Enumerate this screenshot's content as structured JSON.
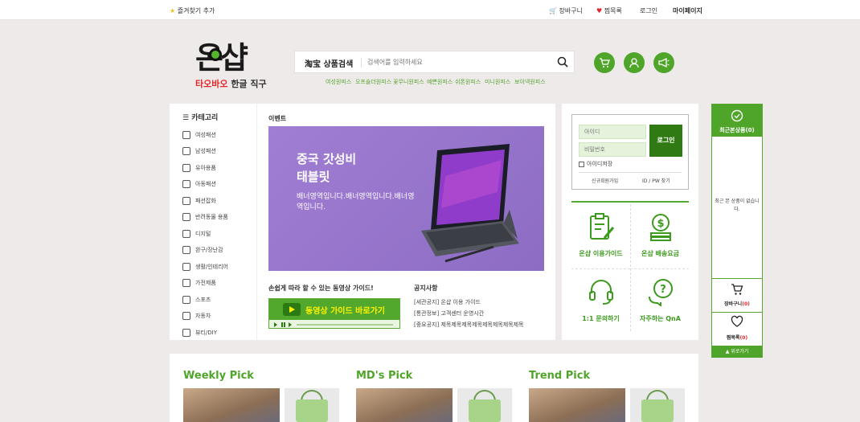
{
  "colors": {
    "brand_green": "#4ea52a",
    "dark_green": "#2f7a12",
    "accent_red": "#e2262b",
    "banner_purple": "#9a7bd0",
    "bg": "#efeaea"
  },
  "topbar": {
    "bookmark_label": "즐겨찾기 추가",
    "cart_label": "장바구니",
    "wishlist_label": "찜목록",
    "login_label": "로그인",
    "mypage_label": "마이페이지"
  },
  "logo": {
    "main": "온샵",
    "sub_red": "타오바오",
    "sub_dark": " 한글 직구"
  },
  "search": {
    "brand_label": "淘宝 상품검색",
    "placeholder": "검색어를 입력하세요",
    "suggestions": [
      "여성원피스",
      "오프숄더원피스",
      "꽃무니원피스",
      "예쁜원피스",
      "쉬폰원피스",
      "미니원피스",
      "보이넥원피스"
    ]
  },
  "header_icons": [
    "cart-icon",
    "user-icon",
    "megaphone-icon"
  ],
  "category": {
    "title": "카테고리",
    "items": [
      "여성패션",
      "남성패션",
      "유아용품",
      "아동패션",
      "패션잡화",
      "반려동물 용품",
      "디지털",
      "완구/장난감",
      "생활/인테리어",
      "가전제품",
      "스포츠",
      "자동차",
      "뷰티/DIY"
    ]
  },
  "event": {
    "title": "이벤트",
    "banner_title": "중국 갓성비\n태블릿",
    "banner_desc": "배너영역입니다.배너영역입니다.배너영역입니다."
  },
  "video_guide": {
    "title": "손쉽게 따라 할 수 있는 동영상 가이드!",
    "button_label": "동영상 가이드 바로가기"
  },
  "notice": {
    "title": "공지사항",
    "items": [
      "[세관공지] 온샵 이용 가이드",
      "[통관정보] 고객센터 운영시간",
      "[중요공지] 제목제목제목제목제목제목제목제목"
    ]
  },
  "login": {
    "id_placeholder": "아이디",
    "pw_placeholder": "비밀번호",
    "button": "로그인",
    "save_id": "아이디저장",
    "signup": "신규회원가입",
    "find": "ID / PW 찾기"
  },
  "services": [
    {
      "label": "온샵 이용가이드",
      "icon": "clipboard-pencil-icon"
    },
    {
      "label": "온샵 배송요금",
      "icon": "dollar-coins-icon"
    },
    {
      "label": "1:1 문의하기",
      "icon": "headset-icon"
    },
    {
      "label": "자주하는 QnA",
      "icon": "qna-bubble-icon"
    }
  ],
  "recent": {
    "title": "최근본상품(0)",
    "empty": "최근 본 상품이 없습니다.",
    "cart_label": "장바구니",
    "cart_count": "(0)",
    "wish_label": "찜목록",
    "wish_count": "(0)",
    "top_label": "위로가기"
  },
  "picks": [
    "Weekly Pick",
    "MD's Pick",
    "Trend Pick"
  ]
}
